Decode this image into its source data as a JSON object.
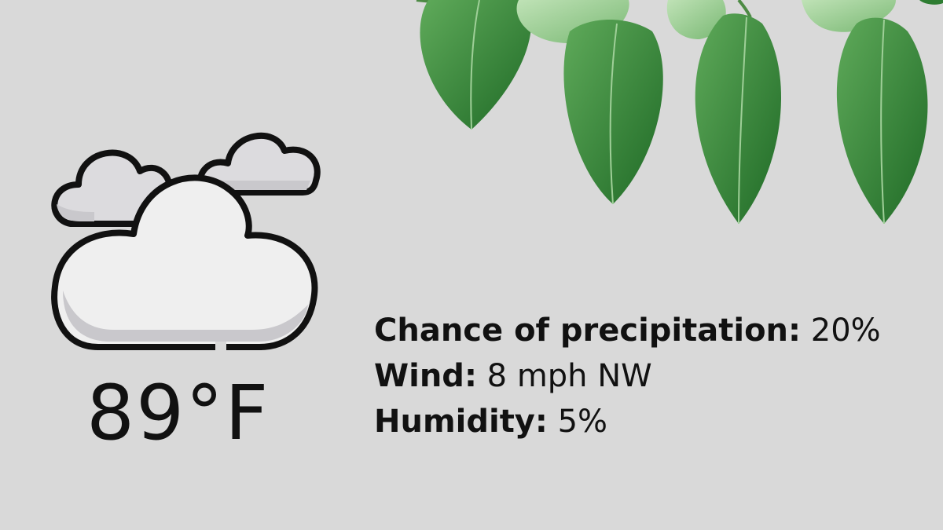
{
  "weather": {
    "icon": "cloudy-icon",
    "temperature": "89°F",
    "precipitation": {
      "label": "Chance of precipitation:",
      "value": "20%"
    },
    "wind": {
      "label": "Wind:",
      "value": "8 mph NW"
    },
    "humidity": {
      "label": "Humidity:",
      "value": "5%"
    }
  },
  "decoration": {
    "icon": "hanging-leaves-icon"
  },
  "colors": {
    "background": "#d9d9d9",
    "text": "#111111",
    "cloud_fill": "#efefef",
    "cloud_shade": "#c9c8cc",
    "leaf_dark": "#2e7d32",
    "leaf_light": "#8fc98b"
  }
}
